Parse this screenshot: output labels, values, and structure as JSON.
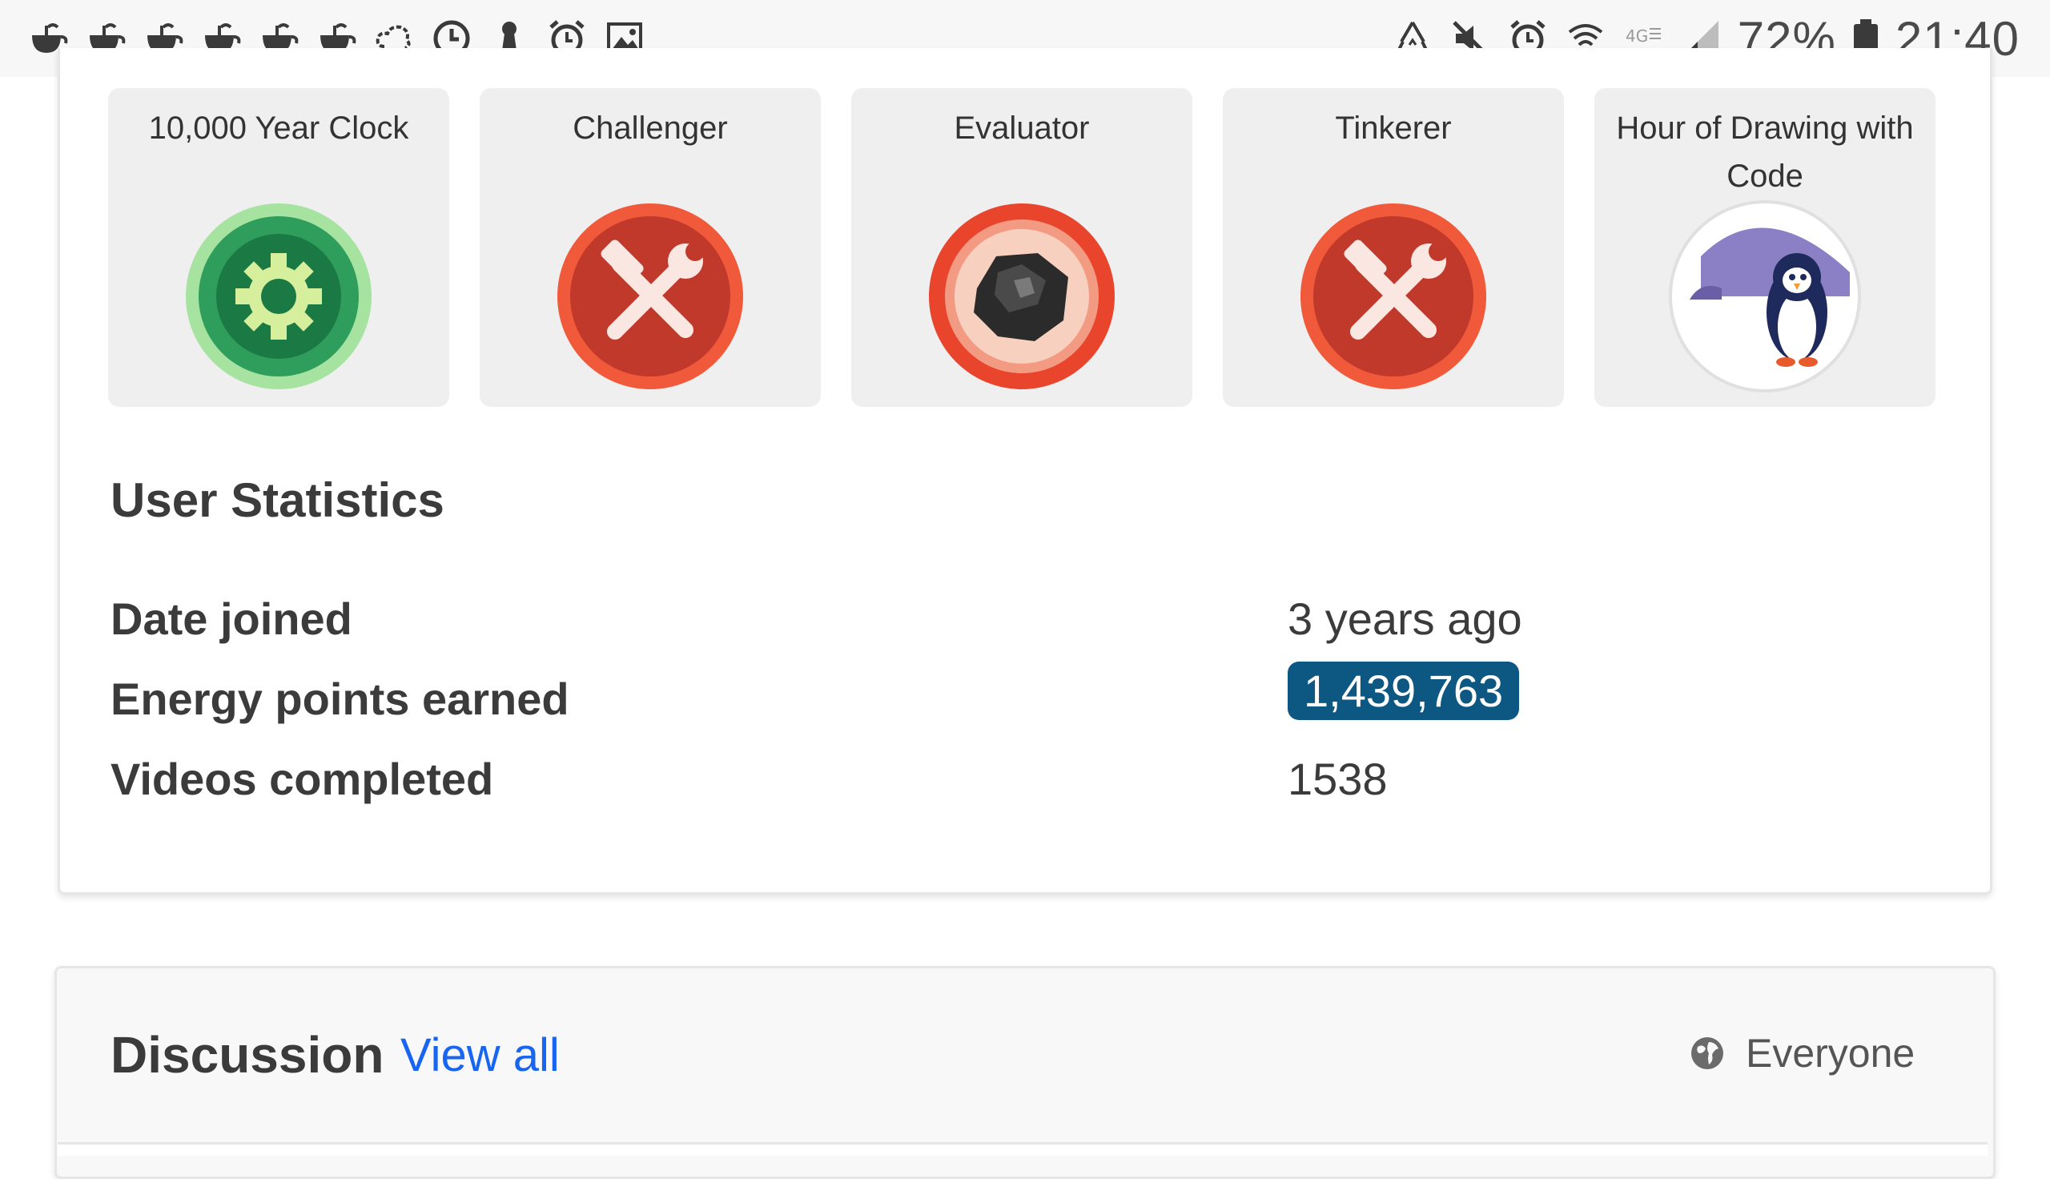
{
  "statusbar": {
    "left_icons": [
      "teapot-icon",
      "teapot-icon",
      "teapot-icon",
      "teapot-icon",
      "teapot-icon",
      "teapot-icon",
      "cloud-sync-icon",
      "clock-icon",
      "keyhole-icon",
      "alarm-icon",
      "image-icon"
    ],
    "right_icons": [
      "recycle-icon",
      "mute-icon",
      "alarm-icon",
      "wifi-icon",
      "lte-icon",
      "signal-icon"
    ],
    "battery": "72%",
    "time": "21:40"
  },
  "badges": [
    {
      "title": "10,000 Year Clock",
      "icon": "gear-badge-icon"
    },
    {
      "title": "Challenger",
      "icon": "tools-badge-icon"
    },
    {
      "title": "Evaluator",
      "icon": "rock-badge-icon"
    },
    {
      "title": "Tinkerer",
      "icon": "tools-badge-icon"
    },
    {
      "title": "Hour of Drawing with Code",
      "icon": "penguin-badge-icon"
    }
  ],
  "stats": {
    "title": "User Statistics",
    "rows": [
      {
        "label": "Date joined",
        "value": "3 years ago"
      },
      {
        "label": "Energy points earned",
        "value": "1,439,763"
      },
      {
        "label": "Videos completed",
        "value": "1538"
      }
    ]
  },
  "discussion": {
    "title": "Discussion",
    "view_all": "View all",
    "scope": "Everyone"
  },
  "colors": {
    "pill": "#0d5783",
    "link": "#1865f2",
    "badge_red": "#d9452b",
    "badge_green": "#2f9e5c"
  }
}
